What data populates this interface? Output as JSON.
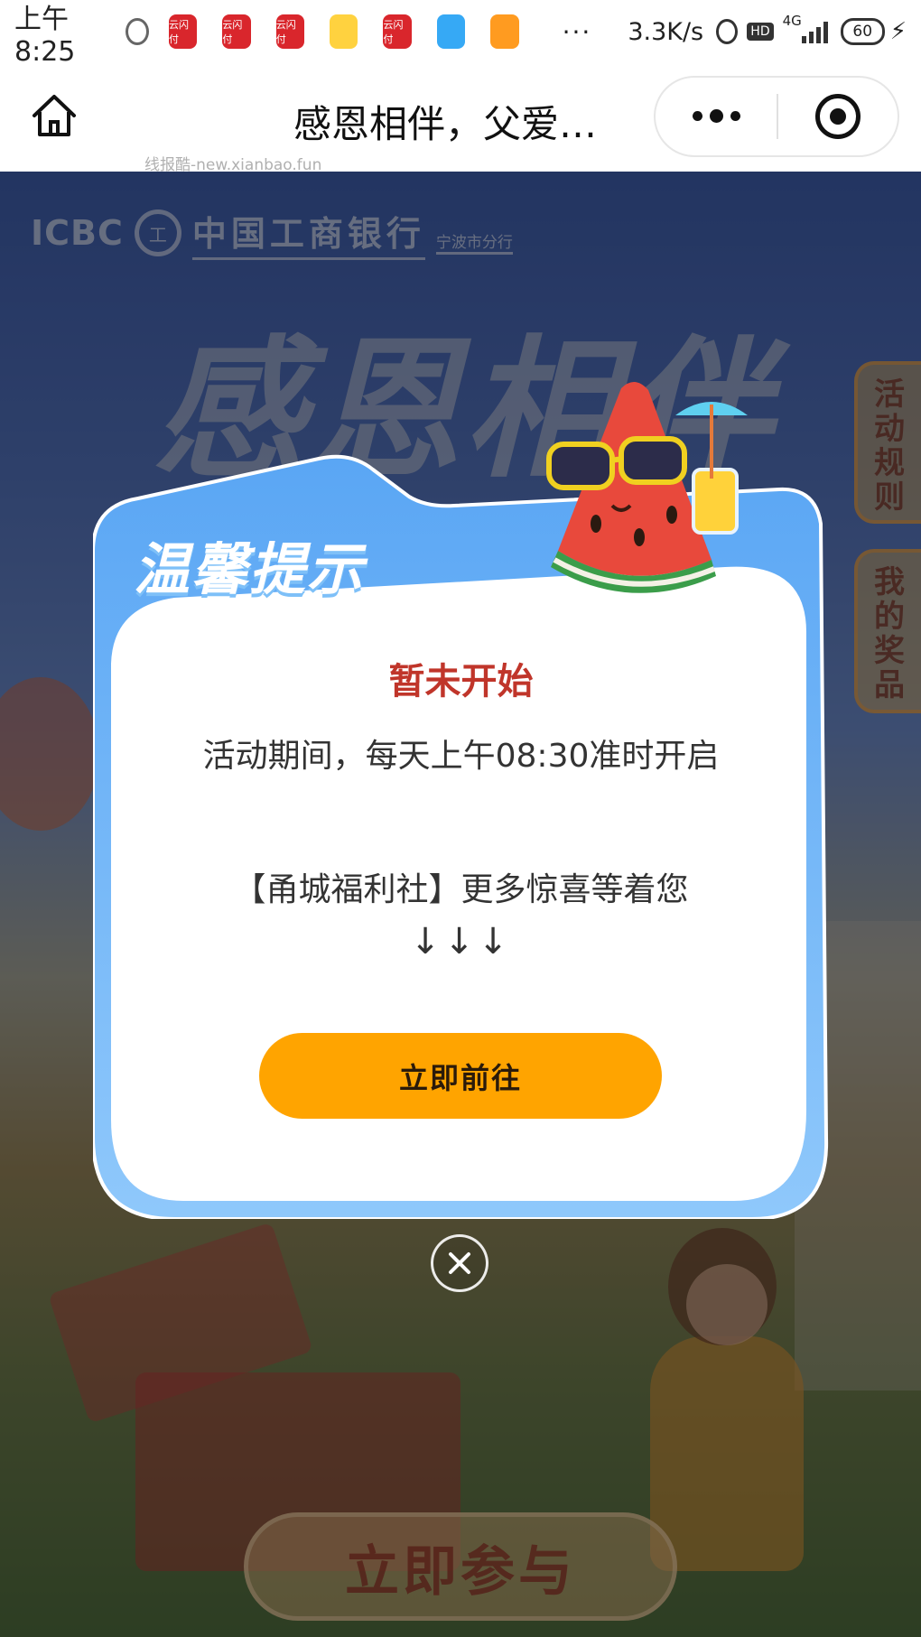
{
  "status_bar": {
    "time": "上午8:25",
    "app_icon_label": "云闪付",
    "dots": "···",
    "net_speed": "3.3K/s",
    "hd": "HD",
    "network": "4G",
    "battery": "60"
  },
  "nav": {
    "title": "感恩相伴，父爱…",
    "watermark": "线报酷-new.xianbao.fun"
  },
  "background": {
    "bank_brand": "ICBC",
    "bank_seal": "工",
    "bank_name": "中国工商银行",
    "branch": "宁波市分行",
    "headline": "感恩相伴",
    "tab_rules": "活动规则",
    "tab_prizes": "我的奖品",
    "join_button": "立即参与"
  },
  "modal": {
    "header": "温馨提示",
    "status": "暂未开始",
    "description": "活动期间，每天上午08:30准时开启",
    "promo": "【甬城福利社】更多惊喜等着您",
    "arrows": "↓↓↓",
    "go_button": "立即前往"
  },
  "colors": {
    "modal_blue": "#6fb2f6",
    "status_red": "#c0352a",
    "button_orange": "#ffa400"
  }
}
